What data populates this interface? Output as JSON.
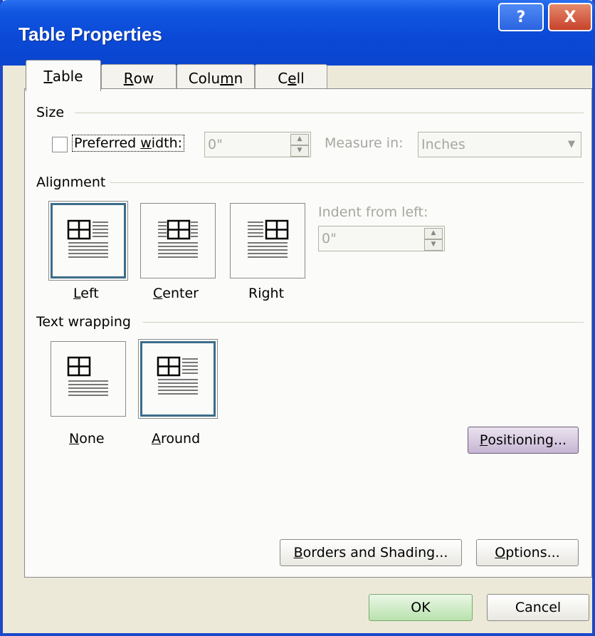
{
  "window": {
    "title": "Table Properties",
    "help_label": "?",
    "close_label": "X"
  },
  "tabs": [
    {
      "pre": "",
      "key": "T",
      "post": "able"
    },
    {
      "pre": "",
      "key": "R",
      "post": "ow"
    },
    {
      "pre": "Colu",
      "key": "m",
      "post": "n"
    },
    {
      "pre": "C",
      "key": "e",
      "post": "ll"
    }
  ],
  "size": {
    "section": "Size",
    "preferred_width": {
      "pre": "Preferred ",
      "key": "w",
      "post": "idth:"
    },
    "width_value": "0\"",
    "measure_label": "Measure in:",
    "measure_value": "Inches"
  },
  "alignment": {
    "section": "Alignment",
    "indent_label": "Indent from left:",
    "indent_value": "0\"",
    "options": [
      {
        "pre": "",
        "key": "L",
        "post": "eft"
      },
      {
        "pre": "",
        "key": "C",
        "post": "enter"
      },
      {
        "pre": "Ri",
        "key": "g",
        "post": "ht"
      }
    ]
  },
  "wrapping": {
    "section": "Text wrapping",
    "options": [
      {
        "pre": "",
        "key": "N",
        "post": "one"
      },
      {
        "pre": "",
        "key": "A",
        "post": "round"
      }
    ],
    "positioning": {
      "pre": "",
      "key": "P",
      "post": "ositioning..."
    }
  },
  "buttons": {
    "borders": {
      "pre": "",
      "key": "B",
      "post": "orders and Shading..."
    },
    "options": {
      "pre": "",
      "key": "O",
      "post": "ptions..."
    },
    "ok": "OK",
    "cancel": "Cancel"
  },
  "colors": {
    "titlebar": "#0b49d6",
    "selection_border": "#3b6d8a",
    "dialog_bg": "#ece9d8"
  }
}
